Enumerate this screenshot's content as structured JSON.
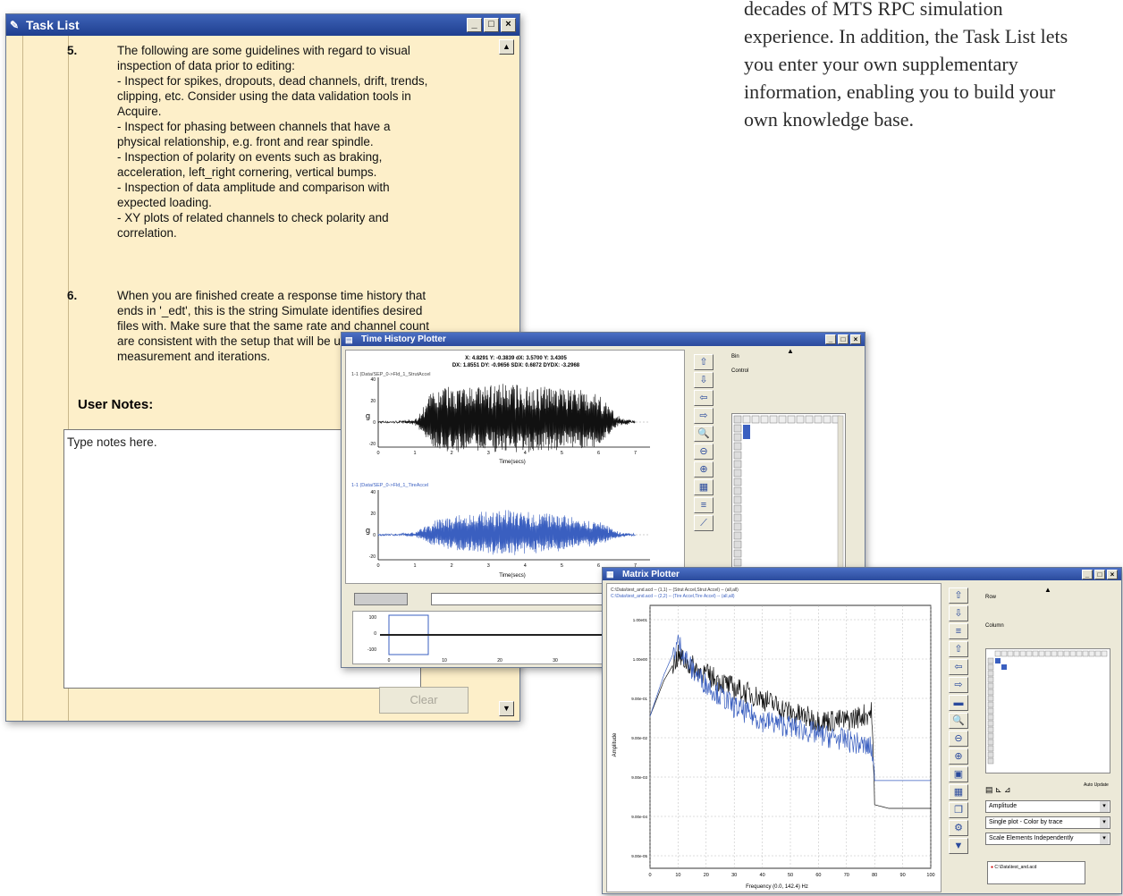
{
  "copy": {
    "lines": [
      "decades of MTS RPC simulation",
      "experience. In addition, the Task List lets",
      "you enter your own supplementary",
      "information, enabling you to build your",
      "own knowledge base."
    ]
  },
  "task_list": {
    "title": "Task List",
    "steps": [
      {
        "number": "5.",
        "text": "The following are some guidelines with regard to visual\ninspection of data prior to editing:\n- Inspect for spikes, dropouts, dead channels, drift, trends,\nclipping, etc. Consider using the data validation tools in\nAcquire.\n- Inspect for phasing between channels that have a\nphysical relationship, e.g. front and rear spindle.\n- Inspection of polarity on events such as braking,\nacceleration, left_right cornering, vertical bumps.\n- Inspection of data amplitude and comparison with\nexpected loading.\n- XY plots of related channels to check polarity and\ncorrelation."
      },
      {
        "number": "6.",
        "text": "When you are finished create a response time history that\nends in '_edt', this is the string Simulate identifies desired\nfiles with. Make sure that the same rate and channel count\nare consistent with the setup that will be used for FRF\nmeasurement and iterations."
      }
    ],
    "user_notes_label": "User Notes:",
    "notes_text": "Type notes here.",
    "clear_label": "Clear"
  },
  "time_history": {
    "title": "Time History Plotter",
    "readout_line1": "X: 4.8291   Y: -0.3839   dX: 3.5700   Y: 3.4305",
    "readout_line2": "DX: 1.8551   DY: -0.9656   SDX: 0.6872   DYDX: -3.2968",
    "plot1_label": "1-1 (Data/SEP_0->Fld_1_StrutAccel",
    "plot2_label": "1-1 (Data/SEP_0->Fld_1_TireAccel",
    "xlabel": "Time(secs)",
    "x_ticks": [
      "0",
      "1",
      "2",
      "3",
      "4",
      "5",
      "6",
      "7"
    ],
    "y_ticks": [
      "40",
      "20",
      "0",
      "-20"
    ],
    "y_unit": "g",
    "side_label1": "Bin",
    "side_label2": "Control",
    "overview_ticks": [
      "0",
      "10",
      "20",
      "30",
      "40"
    ],
    "overview_y": [
      "100",
      "0",
      "-100"
    ]
  },
  "matrix_plotter": {
    "title": "Matrix Plotter",
    "legend1": "C:\\Data\\test_and.acd -- (1,1) -- (Strut Accel,Strut Accel) -- (all,all)",
    "legend2": "C:\\Data\\test_and.acd -- (2,2) -- (Tire Accel,Tire Accel) -- (all,all)",
    "ylabel": "Amplitude",
    "xlabel": "Frequency (0.0, 142.4) Hz",
    "x_ticks": [
      "0",
      "10",
      "20",
      "30",
      "40",
      "50",
      "60",
      "70",
      "80",
      "90",
      "100"
    ],
    "y_ticks": [
      "1.00e01",
      "1.00e00",
      "9.00e-01",
      "9.00e-02",
      "9.00e-03",
      "9.00e-04",
      "9.00e-05"
    ],
    "side_label1": "Row",
    "side_label2": "Column",
    "select1": "Amplitude",
    "select2": "Single plot - Color by trace",
    "select3": "Scale Elements Independently",
    "file_item": "C:\\Data\\test_and.acd",
    "check_label": "Auto Update"
  },
  "chart_data": [
    {
      "type": "line",
      "title": "",
      "xlabel": "Time(secs)",
      "ylabel": "g",
      "xlim": [
        0,
        7.4
      ],
      "ylim": [
        -30,
        45
      ],
      "series": [
        {
          "name": "1-1 (Data/SEP_0->Fld_1_StrutAccel",
          "x": [
            0,
            0.5,
            1,
            1.5,
            2,
            2.5,
            3,
            3.5,
            4,
            4.5,
            5,
            5.5,
            6,
            6.5,
            7
          ],
          "y": [
            0,
            0,
            2,
            30,
            35,
            33,
            34,
            36,
            35,
            34,
            32,
            30,
            28,
            5,
            0
          ]
        },
        {
          "name": "1-1 (Data/SEP_0->Fld_1_TireAccel",
          "x": [
            0,
            0.5,
            1,
            1.5,
            2,
            2.5,
            3,
            3.5,
            4,
            4.5,
            5,
            5.5,
            6,
            6.5,
            7
          ],
          "y": [
            0,
            0,
            2,
            12,
            18,
            20,
            22,
            24,
            22,
            20,
            18,
            15,
            12,
            3,
            0
          ]
        }
      ]
    },
    {
      "type": "line",
      "title": "",
      "xlabel": "Frequency (0.0, 142.4) Hz",
      "ylabel": "Amplitude",
      "xlim": [
        0,
        100
      ],
      "scale": "log",
      "series": [
        {
          "name": "(1,1) Strut Accel",
          "x": [
            0,
            5,
            10,
            15,
            20,
            30,
            40,
            50,
            60,
            70,
            79,
            80,
            85,
            90,
            100
          ],
          "y": [
            0.05,
            0.3,
            1.0,
            0.6,
            0.4,
            0.2,
            0.12,
            0.06,
            0.04,
            0.04,
            0.06,
            0.0006,
            0.0005,
            0.0005,
            0.0005
          ]
        },
        {
          "name": "(2,2) Tire Accel",
          "x": [
            0,
            5,
            10,
            15,
            20,
            30,
            40,
            50,
            60,
            70,
            79,
            80,
            85,
            90,
            100
          ],
          "y": [
            0.05,
            0.4,
            2.0,
            0.5,
            0.25,
            0.08,
            0.04,
            0.03,
            0.02,
            0.015,
            0.01,
            0.002,
            0.002,
            0.002,
            0.002
          ]
        }
      ]
    }
  ]
}
